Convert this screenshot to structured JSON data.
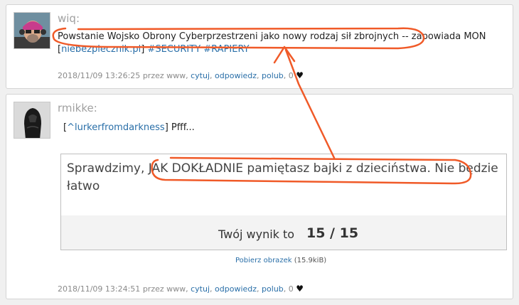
{
  "posts": [
    {
      "username": "wiq:",
      "text_main": "Powstanie Wojsko Obrony Cyberprzestrzeni jako nowy rodzaj sił zbrojnych",
      "text_rest": " -- zapowiada MON",
      "link_open": "[",
      "link_label": "niebezpiecznik.pl",
      "link_close": "]",
      "tags": [
        "#SECURITY",
        "#RAPIERY"
      ],
      "meta": {
        "timestamp": "2018/11/09 13:26:25",
        "by": "przez www,",
        "quote": "cytuj",
        "reply": "odpowiedz",
        "like": "polub",
        "count": "0",
        "heart": "♥"
      }
    },
    {
      "username": "rmikke:",
      "mention_open": "[",
      "mention": "^lurkerfromdarkness",
      "mention_close": "]",
      "text": " Pfff...",
      "embed": {
        "prefix": "Sprawdzimy, ",
        "highlight": "JAK DOKŁADNIE pamiętasz bajki z dzieciństwa",
        "suffix": ". Nie będzie łatwo",
        "score_label": "Twój wynik to",
        "score_value": "15 / 15"
      },
      "download_label": "Pobierz obrazek",
      "download_size": "(15.9kiB)",
      "meta": {
        "timestamp": "2018/11/09 13:24:51",
        "by": "przez www,",
        "quote": "cytuj",
        "reply": "odpowiedz",
        "like": "polub",
        "count": "0",
        "heart": "♥"
      }
    }
  ],
  "colors": {
    "link": "#2a6fa8",
    "annotation": "#f05a28"
  }
}
